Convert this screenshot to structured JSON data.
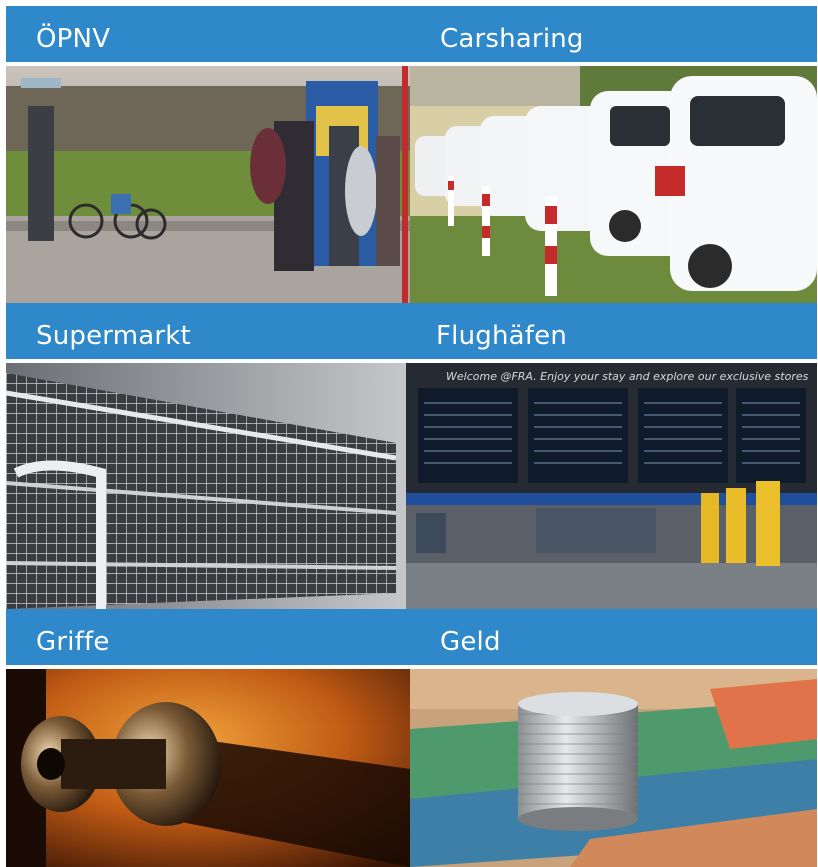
{
  "tiles": [
    {
      "title": "ÖPNV",
      "image": "bus-stop-ticket-machine-photo"
    },
    {
      "title": "Carsharing",
      "image": "parked-white-cars-photo"
    },
    {
      "title": "Supermarkt",
      "image": "shopping-carts-photo"
    },
    {
      "title": "Flughäfen",
      "image": "airport-departure-board-photo"
    },
    {
      "title": "Griffe",
      "image": "door-knob-photo"
    },
    {
      "title": "Geld",
      "image": "coins-and-banknotes-photo"
    }
  ],
  "photo_texts": {
    "airport_banner": "Welcome @FRA. Enjoy your stay and explore our exclusive stores"
  },
  "colors": {
    "header_bar": "#2e88c9",
    "header_text": "#ffffff",
    "background": "#ffffff"
  }
}
